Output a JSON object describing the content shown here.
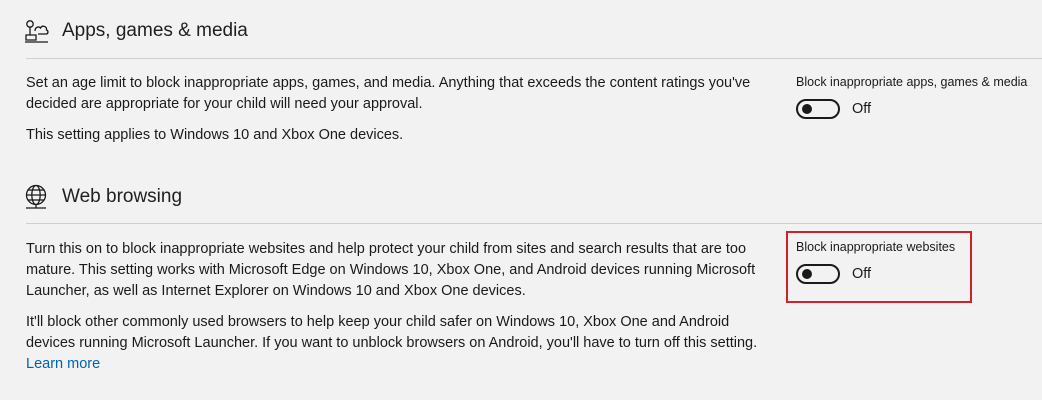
{
  "apps": {
    "icon": "apps-games-icon",
    "title": "Apps, games & media",
    "desc1": "Set an age limit to block inappropriate apps, games, and media. Anything that exceeds the content ratings you've decided are appropriate for your child will need your approval.",
    "desc2": "This setting applies to Windows 10 and Xbox One devices.",
    "toggle_label": "Block inappropriate apps, games & media",
    "toggle_state": "Off"
  },
  "web": {
    "icon": "globe-icon",
    "title": "Web browsing",
    "desc1": "Turn this on to block inappropriate websites and help protect your child from sites and search results that are too mature. This setting works with Microsoft Edge on Windows 10, Xbox One, and Android devices running Microsoft Launcher, as well as Internet Explorer on Windows 10 and Xbox One devices.",
    "desc2": "It'll block other commonly used browsers to help keep your child safer on Windows 10, Xbox One and Android devices running Microsoft Launcher. If you want to unblock browsers on Android, you'll have to turn off this setting.",
    "learn_more": "Learn more",
    "toggle_label": "Block inappropriate websites",
    "toggle_state": "Off"
  },
  "colors": {
    "highlight": "#d0202a",
    "link": "#0063b1",
    "background": "#f2f2f2"
  }
}
